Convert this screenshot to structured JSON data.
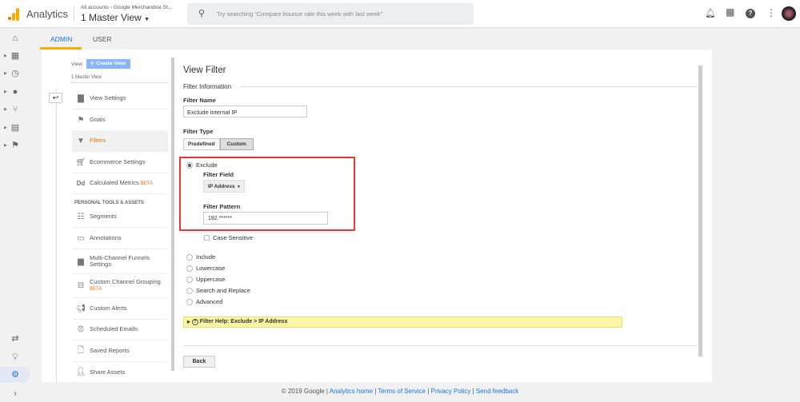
{
  "header": {
    "app_name": "Analytics",
    "breadcrumb_all": "All accounts",
    "breadcrumb_account": "Google Merchandise St...",
    "view_name": "1 Master View",
    "search_placeholder": "Try searching “Compare bounce rate this week with last week”"
  },
  "tabs": [
    {
      "label": "ADMIN",
      "active": true
    },
    {
      "label": "USER",
      "active": false
    }
  ],
  "admin_column": {
    "view_label": "View",
    "create_view": "Create View",
    "view_selected": "1 Master View",
    "items": [
      {
        "label": "View Settings",
        "icon": "file-icon"
      },
      {
        "label": "Goals",
        "icon": "flag-icon"
      },
      {
        "label": "Filters",
        "icon": "filter-icon",
        "active": true
      },
      {
        "label": "Ecommerce Settings",
        "icon": "cart-icon"
      },
      {
        "label": "Calculated Metrics",
        "icon": "dd-icon",
        "badge": "BETA"
      }
    ],
    "section_title": "PERSONAL TOOLS & ASSETS",
    "tools": [
      {
        "label": "Segments",
        "icon": "segments-icon"
      },
      {
        "label": "Annotations",
        "icon": "comment-icon"
      },
      {
        "label": "Multi-Channel Funnels Settings",
        "icon": "bar-chart-icon"
      },
      {
        "label": "Custom Channel Grouping",
        "icon": "grouping-icon",
        "badge": "BETA"
      },
      {
        "label": "Custom Alerts",
        "icon": "megaphone-icon"
      },
      {
        "label": "Scheduled Emails",
        "icon": "alarm-icon"
      },
      {
        "label": "Saved Reports",
        "icon": "document-icon"
      },
      {
        "label": "Share Assets",
        "icon": "person-add-icon"
      }
    ]
  },
  "filter": {
    "title": "View Filter",
    "section": "Filter Information",
    "name_label": "Filter Name",
    "name_value": "Exclude internal IP",
    "type_label": "Filter Type",
    "type_options": [
      "Predefined",
      "Custom"
    ],
    "type_selected": "Custom",
    "exclude_label": "Exclude",
    "field_label": "Filter Field",
    "field_value": "IP Address",
    "pattern_label": "Filter Pattern",
    "pattern_value": "192.******",
    "case_sensitive": "Case Sensitive",
    "other_options": [
      "Include",
      "Lowercase",
      "Uppercase",
      "Search and Replace",
      "Advanced"
    ],
    "help_prefix": "Filter Help: Exclude",
    "help_sep": ">",
    "help_field": "IP Address",
    "back": "Back"
  },
  "footer": {
    "copyright": "© 2019 Google",
    "links": [
      "Analytics home",
      "Terms of Service",
      "Privacy Policy",
      "Send feedback"
    ],
    "sep": "|"
  },
  "colors": {
    "accent": "#f9ab00",
    "link": "#1a73e8",
    "highlight_box": "#e53935",
    "help_bg": "#fbf5a6"
  }
}
